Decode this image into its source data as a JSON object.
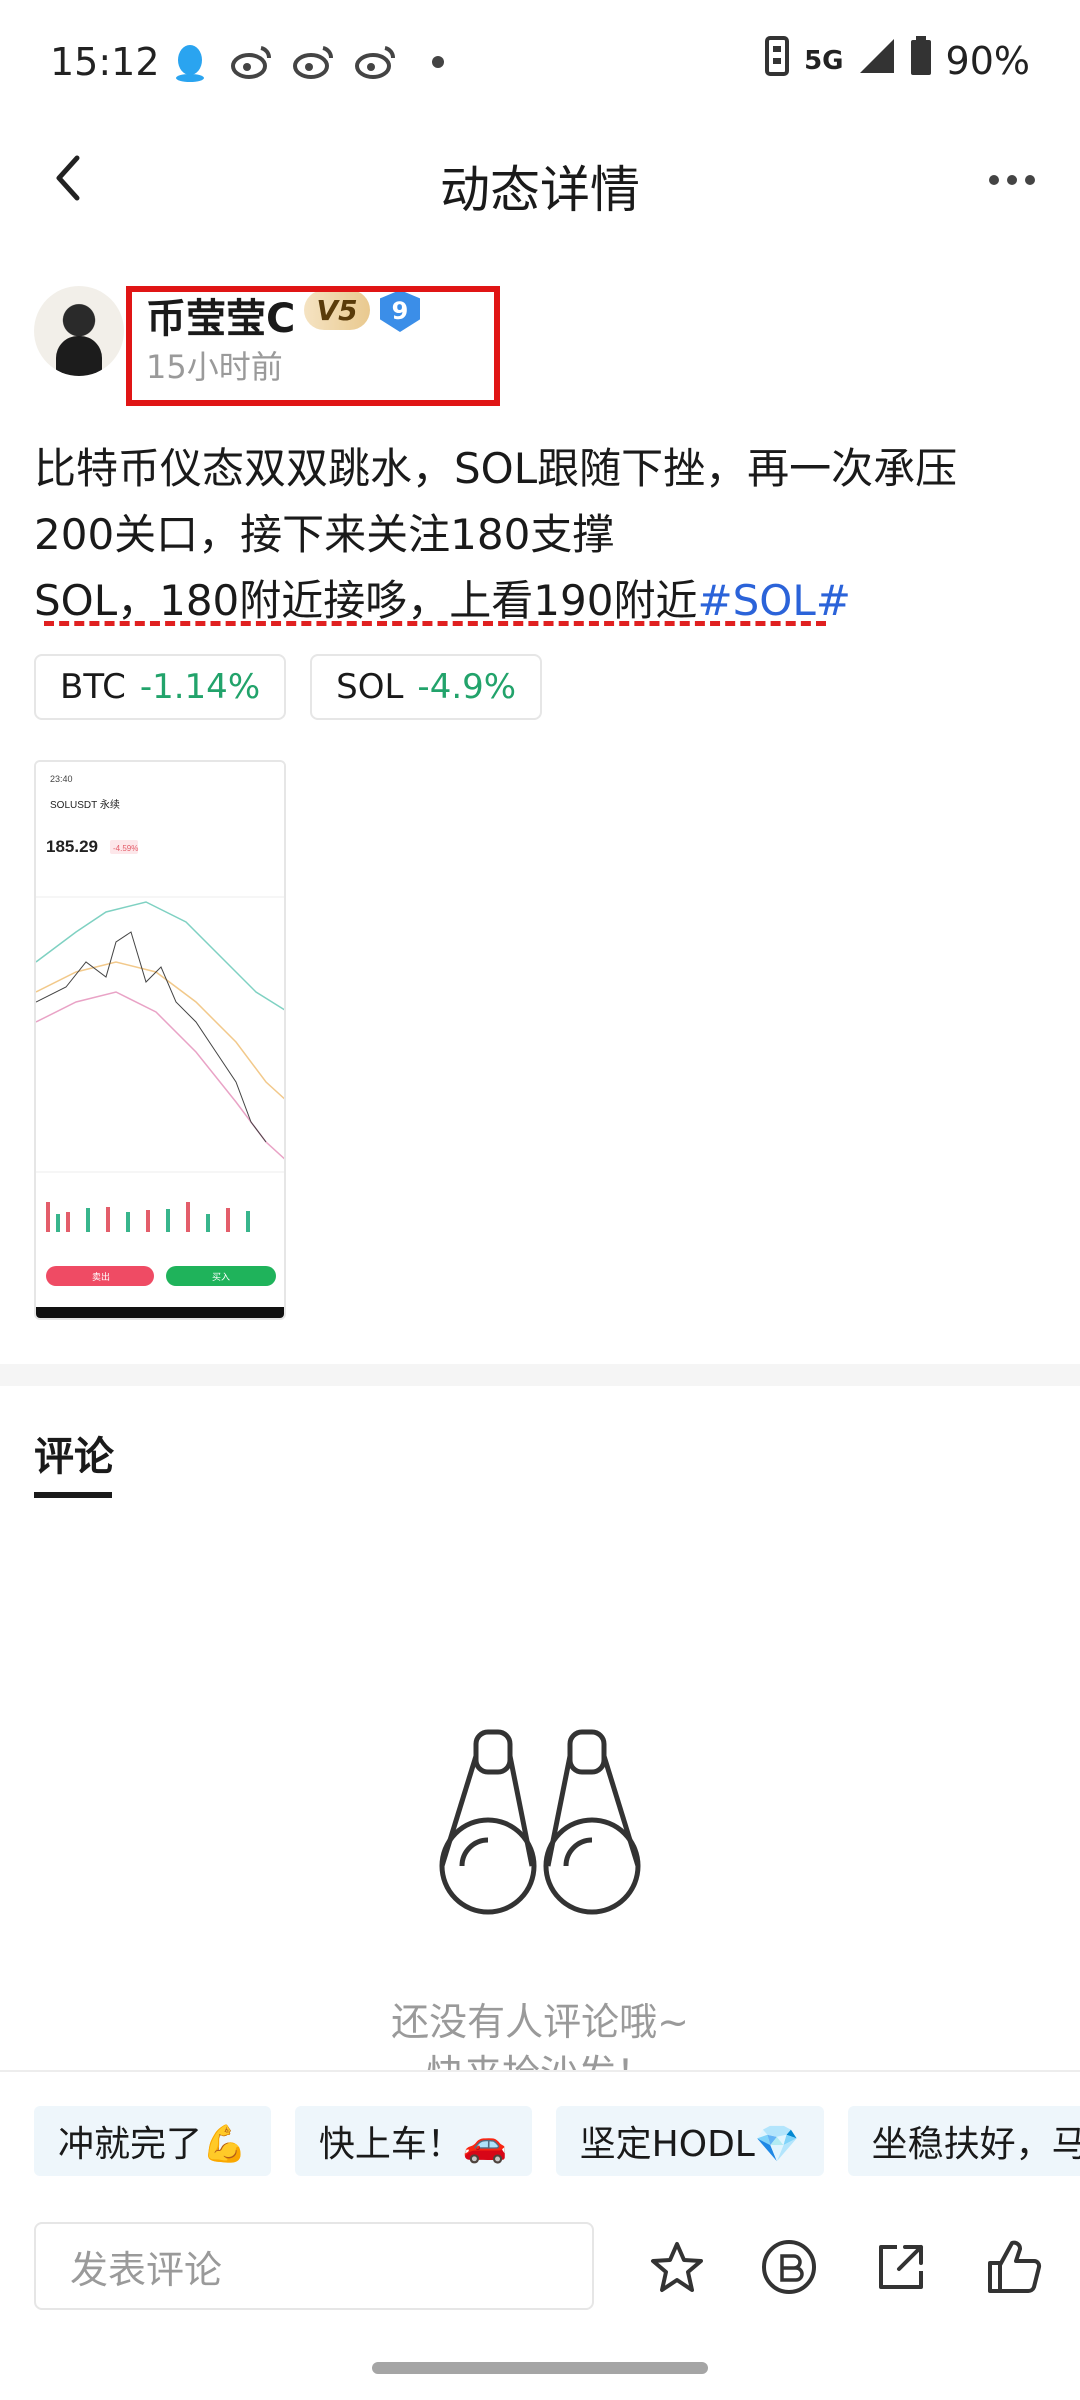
{
  "status_bar": {
    "time": "15:12",
    "notification_icons": [
      "qq-icon",
      "weibo-icon",
      "weibo-icon",
      "weibo-icon",
      "dot-icon"
    ],
    "network": "5G",
    "battery": "90%"
  },
  "nav": {
    "title": "动态详情"
  },
  "post": {
    "author_name": "币莹莹C",
    "vip_level": "V5",
    "user_level": "9",
    "time_ago": "15小时前",
    "lines": [
      "比特币仪态双双跳水，SOL跟随下挫，再一次承压",
      "200关口，接下来关注180支撑",
      "SOL，180附近接哆，上看190附近"
    ],
    "hashtag": "#SOL#",
    "coins": [
      {
        "symbol": "BTC",
        "change": "-1.14%"
      },
      {
        "symbol": "SOL",
        "change": "-4.9%"
      }
    ],
    "image": {
      "time": "23:40",
      "pair": "SOLUSDT 永续",
      "price": "185.29",
      "price_change": "-4.59%",
      "sell_label": "卖出",
      "buy_label": "买入"
    }
  },
  "comments": {
    "tab_label": "评论",
    "empty_line1": "还没有人评论哦~",
    "empty_line2": "快来抢沙发！"
  },
  "quick_replies": [
    "冲就完了💪",
    "快上车！🚗",
    "坚定HODL💎",
    "坐稳扶好，马"
  ],
  "input": {
    "placeholder": "发表评论"
  },
  "colors": {
    "positive": "#22a36b",
    "hashtag": "#2b63d9",
    "highlight": "#e01515"
  }
}
